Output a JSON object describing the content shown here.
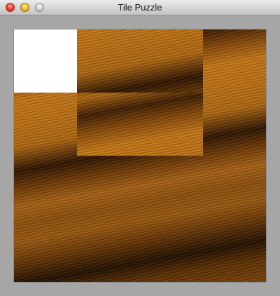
{
  "window": {
    "title": "Tile Puzzle"
  },
  "puzzle": {
    "grid_size": 4,
    "blank_color": "#ffffff",
    "fur_colors": [
      "#c77a1c",
      "#8a4c0c",
      "#2a1304"
    ],
    "tiles": [
      {
        "row": 0,
        "col": 0,
        "piece": null
      },
      {
        "row": 0,
        "col": 1,
        "piece": 5
      },
      {
        "row": 0,
        "col": 2,
        "piece": 6
      },
      {
        "row": 0,
        "col": 3,
        "piece": 3
      },
      {
        "row": 1,
        "col": 0,
        "piece": 4
      },
      {
        "row": 1,
        "col": 1,
        "piece": 1
      },
      {
        "row": 1,
        "col": 2,
        "piece": 2
      },
      {
        "row": 1,
        "col": 3,
        "piece": 7
      },
      {
        "row": 2,
        "col": 0,
        "piece": 8
      },
      {
        "row": 2,
        "col": 1,
        "piece": 9
      },
      {
        "row": 2,
        "col": 2,
        "piece": 10
      },
      {
        "row": 2,
        "col": 3,
        "piece": 11
      },
      {
        "row": 3,
        "col": 0,
        "piece": 12
      },
      {
        "row": 3,
        "col": 1,
        "piece": 13
      },
      {
        "row": 3,
        "col": 2,
        "piece": 14
      },
      {
        "row": 3,
        "col": 3,
        "piece": 15
      }
    ]
  }
}
